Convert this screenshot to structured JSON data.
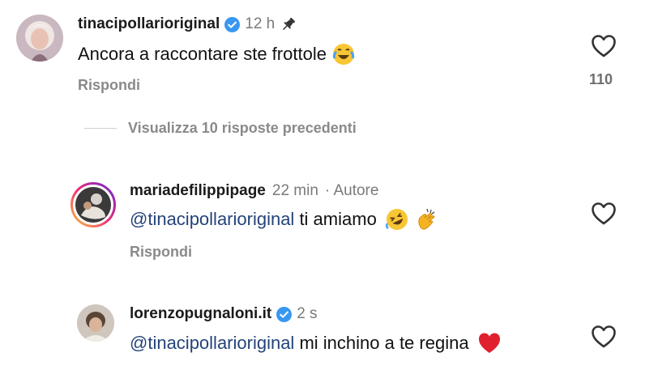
{
  "comments": [
    {
      "username": "tinacipollarioriginal",
      "time": "12 h",
      "text": "Ancora a raccontare  ste frottole",
      "reply_label": "Rispondi",
      "likes": "110",
      "verified": true,
      "pinned": true,
      "emoji": "face-with-tears-of-joy-icon"
    },
    {
      "username": "mariadefilippipage",
      "time": "22 min",
      "author_label": "· Autore",
      "mention": "@tinacipollarioriginal",
      "text": " ti amiamo",
      "reply_label": "Rispondi",
      "emoji": [
        "rolling-laughing-icon",
        "clapping-hands-icon"
      ]
    },
    {
      "username": "lorenzopugnaloni.it",
      "time": "2 s",
      "mention": "@tinacipollarioriginal",
      "text": " mi inchino a te regina",
      "verified": true,
      "emoji": "red-heart-icon"
    }
  ],
  "view_previous": "Visualizza 10 risposte precedenti",
  "colors": {
    "mention": "#24437a",
    "verified": "#3897f0",
    "muted": "#8a8a8a"
  }
}
